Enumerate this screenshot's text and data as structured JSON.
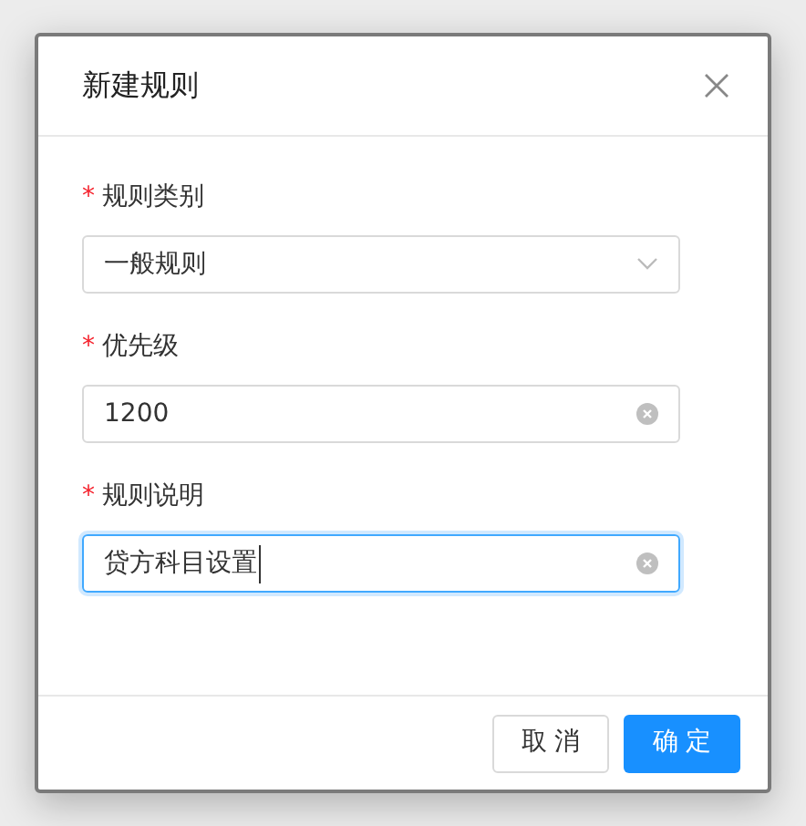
{
  "dialog": {
    "title": "新建规则",
    "fields": [
      {
        "kind": "select",
        "marker": "*",
        "label": "规则类别",
        "value": "一般规则",
        "focused": false
      },
      {
        "kind": "input",
        "marker": "*",
        "label": "优先级",
        "value": "1200",
        "focused": false
      },
      {
        "kind": "input",
        "marker": "*",
        "label": "规则说明",
        "value": "贷方科目设置",
        "focused": true
      }
    ],
    "buttons": [
      {
        "kind": "default",
        "label": "取 消"
      },
      {
        "kind": "primary",
        "label": "确 定"
      }
    ]
  }
}
